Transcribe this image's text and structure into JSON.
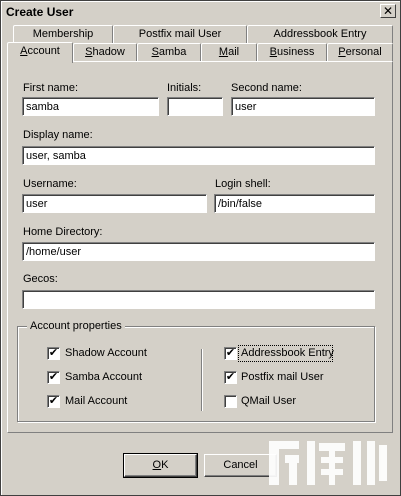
{
  "window": {
    "title": "Create User",
    "close_symbol": "✕"
  },
  "tabs_back": [
    {
      "label": "Membership"
    },
    {
      "label": "Postfix mail User"
    },
    {
      "label": "Addressbook Entry"
    }
  ],
  "tabs_front": [
    {
      "pre": "",
      "u": "A",
      "post": "ccount",
      "active": true
    },
    {
      "pre": "",
      "u": "S",
      "post": "hadow"
    },
    {
      "pre": "",
      "u": "S",
      "post": "amba"
    },
    {
      "pre": "",
      "u": "M",
      "post": "ail"
    },
    {
      "pre": "",
      "u": "B",
      "post": "usiness"
    },
    {
      "pre": "",
      "u": "P",
      "post": "ersonal"
    }
  ],
  "form": {
    "first_name": {
      "label": "First name:",
      "value": "samba"
    },
    "initials": {
      "label": "Initials:",
      "value": ""
    },
    "second_name": {
      "label": "Second name:",
      "value": "user"
    },
    "display_name": {
      "label": "Display name:",
      "value": "user, samba"
    },
    "username": {
      "label": "Username:",
      "value": "user"
    },
    "login_shell": {
      "label": "Login shell:",
      "value": "/bin/false"
    },
    "home_directory": {
      "label": "Home Directory:",
      "value": "/home/user"
    },
    "gecos": {
      "label": "Gecos:",
      "value": ""
    }
  },
  "account_properties": {
    "title": "Account properties",
    "left": [
      {
        "label": "Shadow Account",
        "checked": true
      },
      {
        "label": "Samba Account",
        "checked": true
      },
      {
        "label": "Mail Account",
        "checked": true
      }
    ],
    "right": [
      {
        "label": "Addressbook Entry",
        "checked": true
      },
      {
        "label": "Postfix mail User",
        "checked": true
      },
      {
        "label": "QMail User",
        "checked": false
      }
    ],
    "check_mark": "✔"
  },
  "buttons": {
    "ok": {
      "u": "O",
      "post": "K"
    },
    "cancel": {
      "label": "Cancel"
    }
  }
}
